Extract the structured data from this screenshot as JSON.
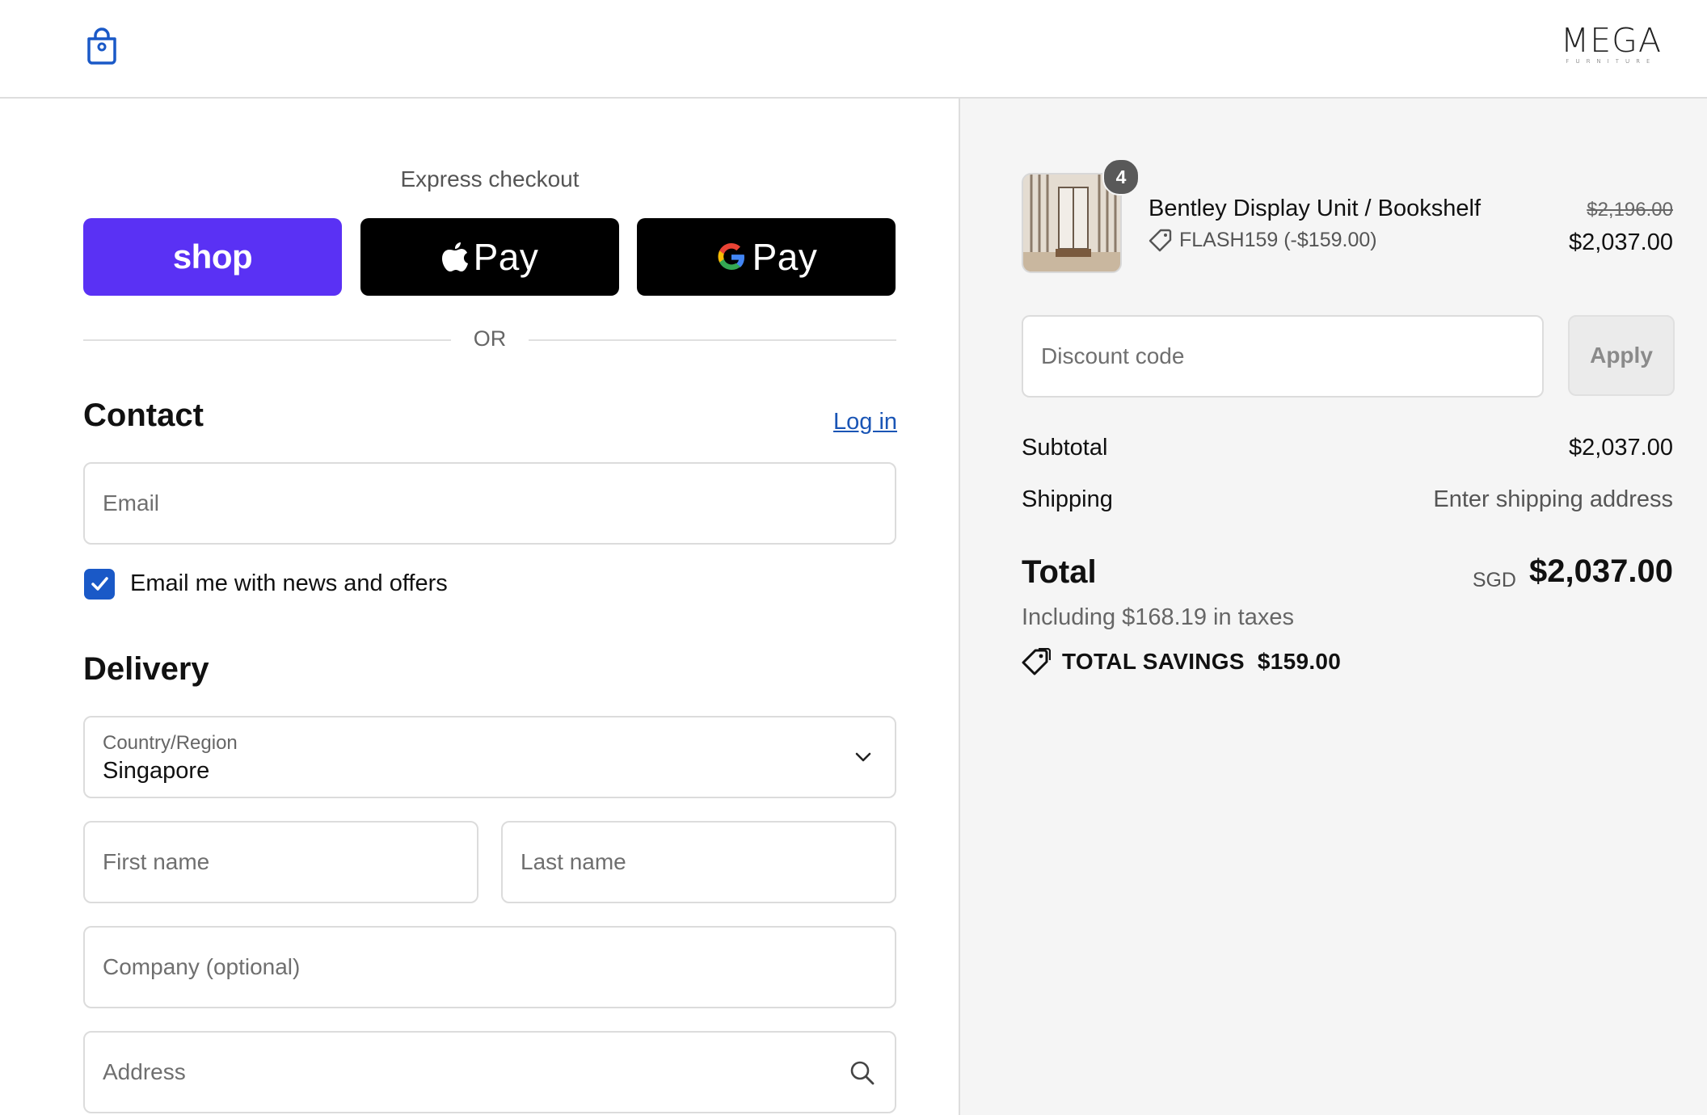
{
  "header": {
    "cart_icon": "shopping-bag-icon",
    "brand_name": "MEGA",
    "brand_sub": "FURNITURE"
  },
  "express": {
    "label": "Express checkout",
    "shop_label": "shop",
    "apple_label": "Pay",
    "google_label": "Pay",
    "divider": "OR"
  },
  "contact": {
    "title": "Contact",
    "login": "Log in",
    "email_placeholder": "Email",
    "newsletter_label": "Email me with news and offers",
    "newsletter_checked": true
  },
  "delivery": {
    "title": "Delivery",
    "country_label": "Country/Region",
    "country_value": "Singapore",
    "first_name": "First name",
    "last_name": "Last name",
    "company": "Company (optional)",
    "address": "Address"
  },
  "summary": {
    "product_name": "Bentley Display Unit / Bookshelf",
    "quantity": "4",
    "discount_code": "FLASH159 (-$159.00)",
    "old_price": "$2,196.00",
    "new_price": "$2,037.00",
    "discount_placeholder": "Discount code",
    "apply": "Apply",
    "subtotal_label": "Subtotal",
    "subtotal_value": "$2,037.00",
    "shipping_label": "Shipping",
    "shipping_value": "Enter shipping address",
    "total_label": "Total",
    "currency": "SGD",
    "total_value": "$2,037.00",
    "tax_line": "Including $168.19 in taxes",
    "savings_label": "TOTAL SAVINGS",
    "savings_value": "$159.00"
  },
  "colors": {
    "shop_purple": "#5a31f4",
    "link_blue": "#1a55b5",
    "checkbox_blue": "#1a59c7"
  }
}
